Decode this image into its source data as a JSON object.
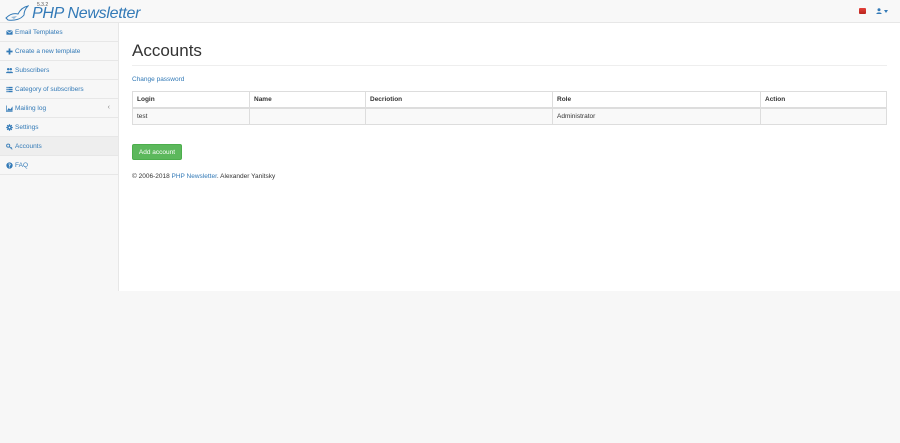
{
  "brand": {
    "version": "5.3.2",
    "name": "PHP Newsletter"
  },
  "colors": {
    "link": "#337ab7",
    "success": "#5cb85c",
    "flag": "#d9342b"
  },
  "sidebar": {
    "items": [
      {
        "label": "Email Templates",
        "icon": "envelope-icon"
      },
      {
        "label": "Create a new template",
        "icon": "plus-icon"
      },
      {
        "label": "Subscribers",
        "icon": "users-icon"
      },
      {
        "label": "Category of subscribers",
        "icon": "list-icon"
      },
      {
        "label": "Mailing log",
        "icon": "chart-icon",
        "chevron": "‹"
      },
      {
        "label": "Settings",
        "icon": "gear-icon"
      },
      {
        "label": "Accounts",
        "icon": "key-icon",
        "active": true
      },
      {
        "label": "FAQ",
        "icon": "question-icon"
      }
    ]
  },
  "main": {
    "title": "Accounts",
    "change_password": "Change password",
    "table": {
      "headers": [
        "Login",
        "Name",
        "Decriotion",
        "Role",
        "Action"
      ],
      "rows": [
        [
          "test",
          "",
          "",
          "Administrator",
          ""
        ]
      ]
    },
    "add_button": "Add account",
    "footer": {
      "prefix": "© 2006-2018 ",
      "link": "PHP Newsletter",
      "suffix": ". Alexander Yanitsky"
    }
  }
}
